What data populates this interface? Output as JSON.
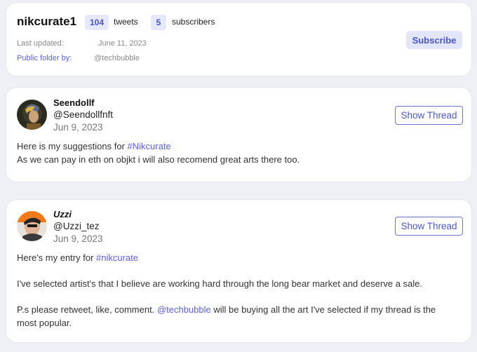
{
  "folder": {
    "name": "nikcurate1",
    "tweets_count": "104",
    "tweets_label": "tweets",
    "subscribers_count": "5",
    "subscribers_label": "subscribers",
    "last_updated_label": "Last updated:",
    "last_updated_value": "June 11, 2023",
    "public_folder_label": "Public folder by:",
    "public_folder_owner": "@techbubble",
    "subscribe_label": "Subscribe"
  },
  "tweets": [
    {
      "display_name": "Seendollf",
      "handle": "@Seendollfnft",
      "date": "Jun 9, 2023",
      "thread_label": "Show Thread",
      "lines": [
        {
          "before": "Here is my suggestions for ",
          "hashtag": "#Nikcurate",
          "after": ""
        },
        {
          "text": "As we can pay in eth on objkt i will also recomend great arts there too."
        }
      ]
    },
    {
      "display_name": "Uzzi",
      "handle": "@Uzzi_tez",
      "date": "Jun 9, 2023",
      "thread_label": "Show Thread",
      "lines": [
        {
          "before": "Here's my entry for ",
          "hashtag": "#nikcurate"
        },
        {
          "text": "I've selected artist's that I believe are working hard through the long bear market and deserve a sale."
        },
        {
          "before": "P.s please retweet, like, comment. ",
          "mention": "@techbubble",
          "after": " will be buying all the art I've selected if my thread is the"
        },
        {
          "text": "most popular."
        }
      ]
    }
  ],
  "colors": {
    "accent": "#5a62d8",
    "pill_bg": "#e6e8fb",
    "page_bg": "#eef0f6"
  }
}
